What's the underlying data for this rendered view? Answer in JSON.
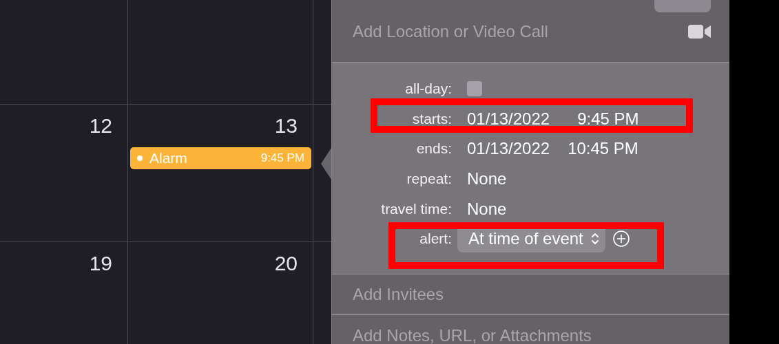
{
  "calendar": {
    "weeks": [
      {
        "days": [
          {
            "number": "12"
          },
          {
            "number": "13",
            "events": [
              {
                "title": "Alarm",
                "time": "9:45 PM"
              }
            ]
          }
        ]
      },
      {
        "days": [
          {
            "number": "19"
          },
          {
            "number": "20"
          }
        ]
      }
    ]
  },
  "event_popover": {
    "location_placeholder": "Add Location or Video Call",
    "fields": [
      {
        "kind": "checkbox",
        "label": "all-day:",
        "checked": false,
        "highlighted": false
      },
      {
        "kind": "datetime",
        "label": "starts:",
        "date": "01/13/2022",
        "time": "9:45 PM",
        "highlighted": true
      },
      {
        "kind": "datetime",
        "label": "ends:",
        "date": "01/13/2022",
        "time": "10:45 PM",
        "highlighted": false
      },
      {
        "kind": "text",
        "label": "repeat:",
        "value": "None",
        "highlighted": false
      },
      {
        "kind": "text",
        "label": "travel time:",
        "value": "None",
        "highlighted": false
      },
      {
        "kind": "select",
        "label": "alert:",
        "value": "At time of event",
        "highlighted": true
      }
    ],
    "invitees_placeholder": "Add Invitees",
    "notes_placeholder": "Add Notes, URL, or Attachments"
  }
}
